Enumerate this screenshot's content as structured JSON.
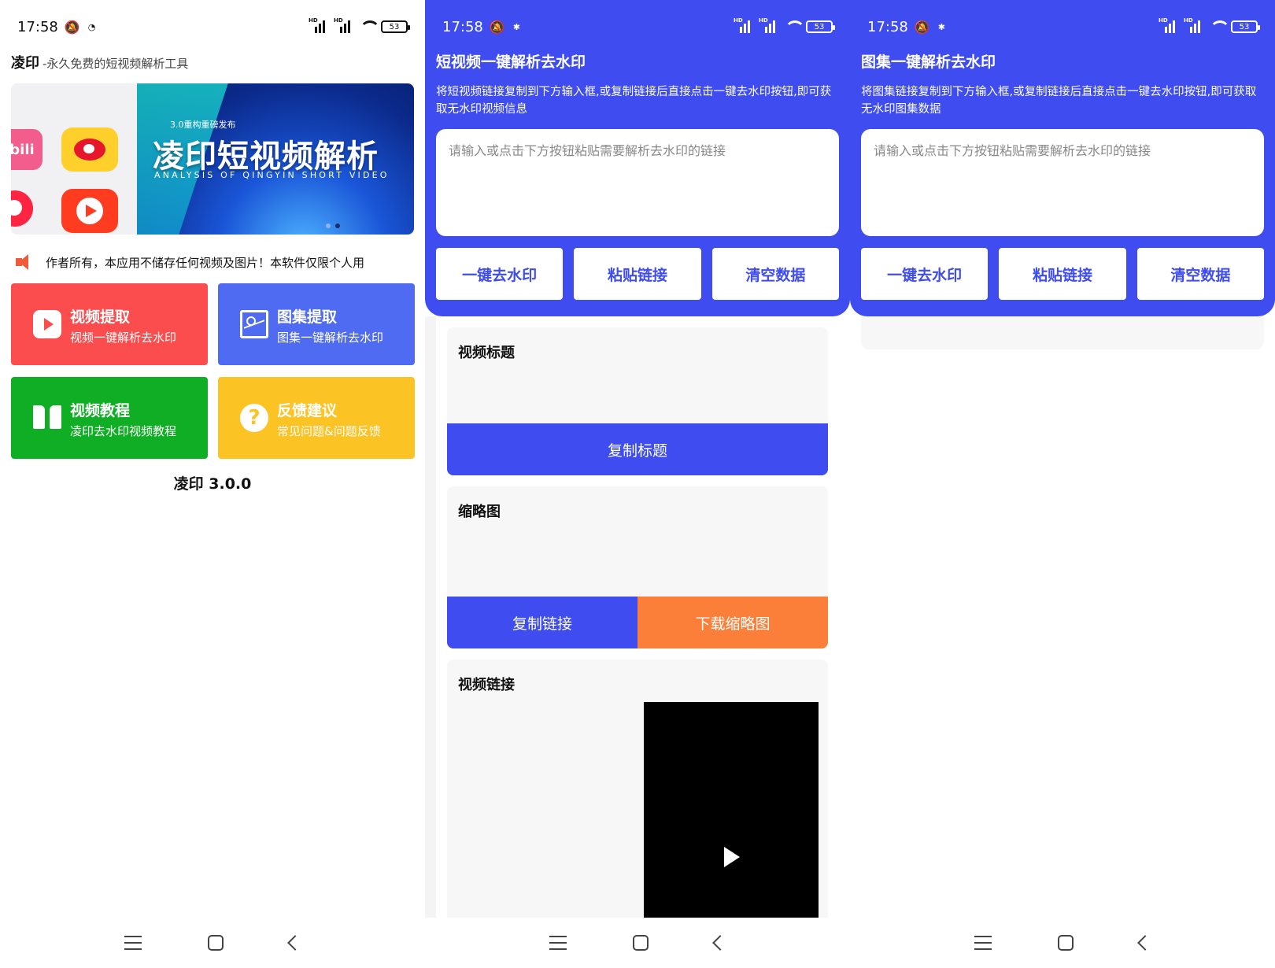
{
  "status": {
    "time": "17:58",
    "battery": "53"
  },
  "screen1": {
    "app_name": "凌印",
    "app_tagline": "-永久免费的短视频解析工具",
    "banner": {
      "subtitle": "3.0重构重磅发布",
      "title": "凌印短视频解析",
      "english": "ANALYSIS OF QINGYIN SHORT VIDEO",
      "bili_text": "bili"
    },
    "notice": "作者所有，本应用不储存任何视频及图片！本软件仅限个人用",
    "tiles": [
      {
        "title": "视频提取",
        "subtitle": "视频一键解析去水印",
        "color": "#fb4d4d"
      },
      {
        "title": "图集提取",
        "subtitle": "图集一键解析去水印",
        "color": "#4f6bf2"
      },
      {
        "title": "视频教程",
        "subtitle": "凌印去水印视频教程",
        "color": "#10ae24"
      },
      {
        "title": "反馈建议",
        "subtitle": "常见问题&问题反馈",
        "color": "#fcc325"
      }
    ],
    "version": "凌印 3.0.0"
  },
  "screen2": {
    "title": "短视频一键解析去水印",
    "description": "将短视频链接复制到下方输入框,或复制链接后直接点击一键去水印按钮,即可获取无水印视频信息",
    "input_placeholder": "请输入或点击下方按钮粘贴需要解析去水印的链接",
    "buttons": {
      "remove": "一键去水印",
      "paste": "粘贴链接",
      "clear": "清空数据"
    },
    "card_title": {
      "label": "视频标题",
      "button": "复制标题"
    },
    "card_thumb": {
      "label": "缩略图",
      "copy_link": "复制链接",
      "download": "下载缩略图"
    },
    "card_link": {
      "label": "视频链接"
    }
  },
  "screen3": {
    "title": "图集一键解析去水印",
    "description": "将图集链接复制到下方输入框,或复制链接后直接点击一键去水印按钮,即可获取无水印图集数据",
    "input_placeholder": "请输入或点击下方按钮粘贴需要解析去水印的链接",
    "buttons": {
      "remove": "一键去水印",
      "paste": "粘贴链接",
      "clear": "清空数据"
    }
  },
  "colors": {
    "primary_blue": "#3e4cf0",
    "orange": "#fb7f39"
  }
}
